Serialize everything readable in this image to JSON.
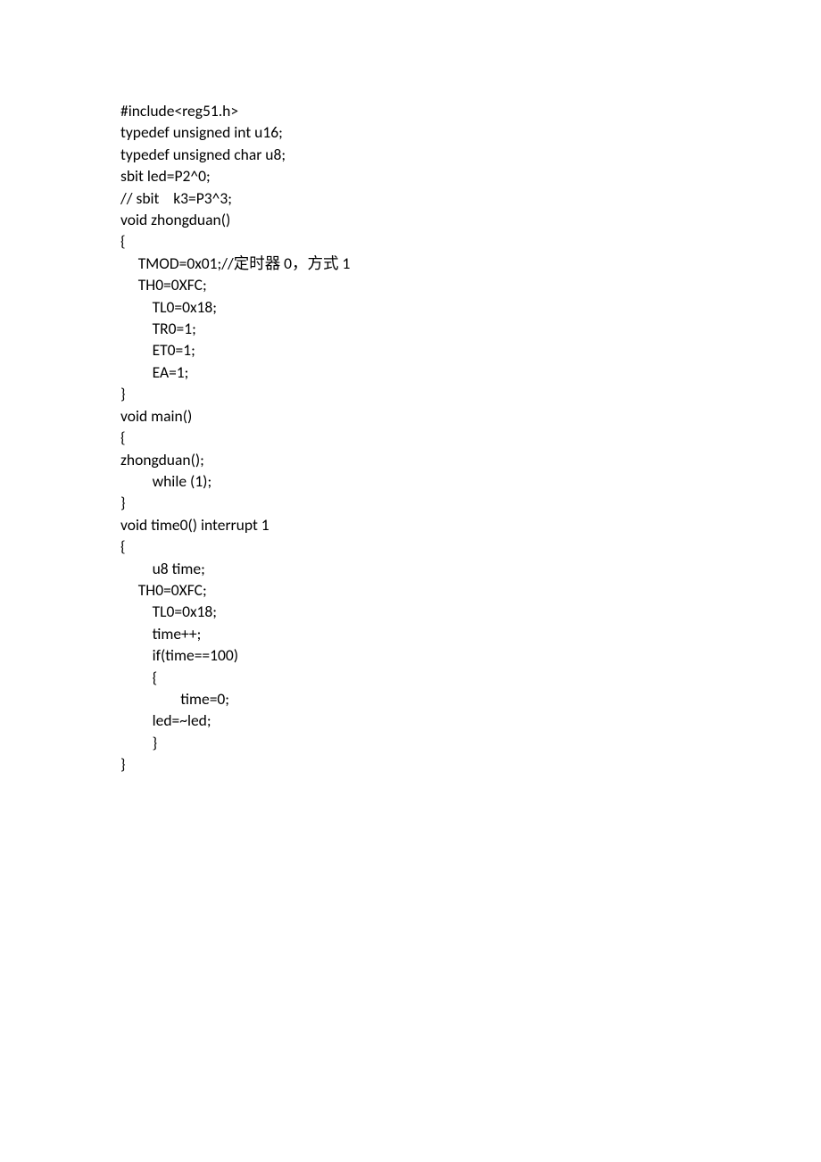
{
  "code": {
    "lines": [
      "#include<reg51.h>",
      "typedef unsigned int u16;",
      "typedef unsigned char u8;",
      "sbit led=P2^0;",
      "// sbit    k3=P3^3;",
      "void zhongduan()",
      "{",
      "     TMOD=0x01;//定时器 0，方式 1",
      "     TH0=0XFC;",
      "         TL0=0x18;",
      "         TR0=1;",
      "         ET0=1;",
      "         EA=1;",
      "}",
      "void main()",
      "{",
      "zhongduan();",
      "         while (1);",
      "}",
      "void time0() interrupt 1",
      "{",
      "         u8 time;",
      "     TH0=0XFC;",
      "         TL0=0x18;",
      "         time++;",
      "         if(time==100)",
      "         {",
      "                 time=0;",
      "         led=~led;",
      "         }",
      "}"
    ]
  }
}
